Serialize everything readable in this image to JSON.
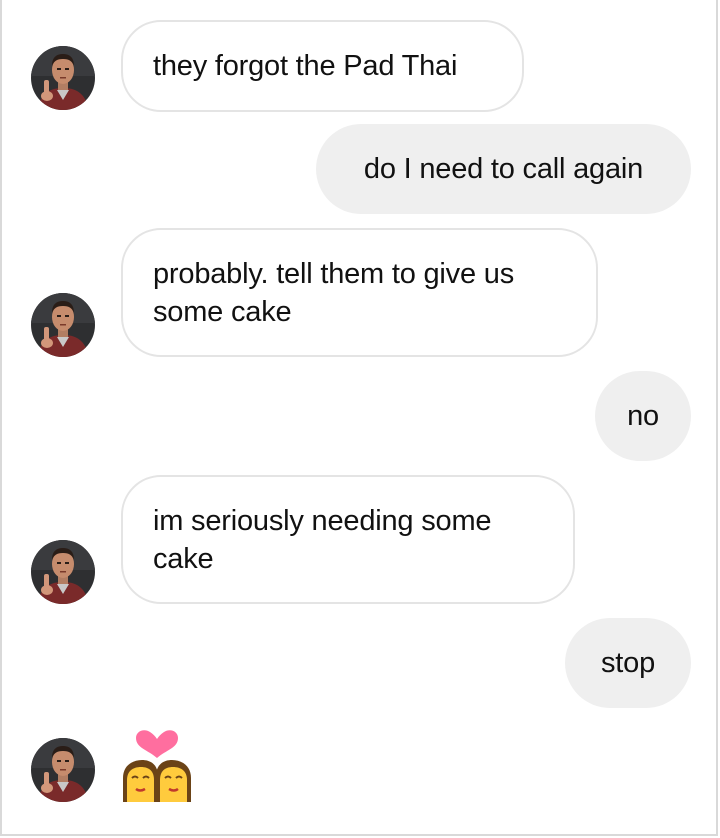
{
  "conversation": {
    "messages": [
      {
        "sender": "other",
        "text": "they forgot the Pad Thai"
      },
      {
        "sender": "me",
        "text": "do I need to call again"
      },
      {
        "sender": "other",
        "text": "probably. tell them to give us some cake"
      },
      {
        "sender": "me",
        "text": "no"
      },
      {
        "sender": "other",
        "text": "im seriously needing some cake"
      },
      {
        "sender": "me",
        "text": "stop"
      },
      {
        "sender": "other",
        "icon": "couple-with-heart-icon"
      }
    ]
  },
  "colors": {
    "incoming_bubble_bg": "#ffffff",
    "incoming_bubble_border": "#e4e4e4",
    "outgoing_bubble_bg": "#efefef",
    "text": "#111111"
  },
  "icons": {
    "avatar": "contact-avatar-icon",
    "reaction": "couple-with-heart-icon"
  }
}
